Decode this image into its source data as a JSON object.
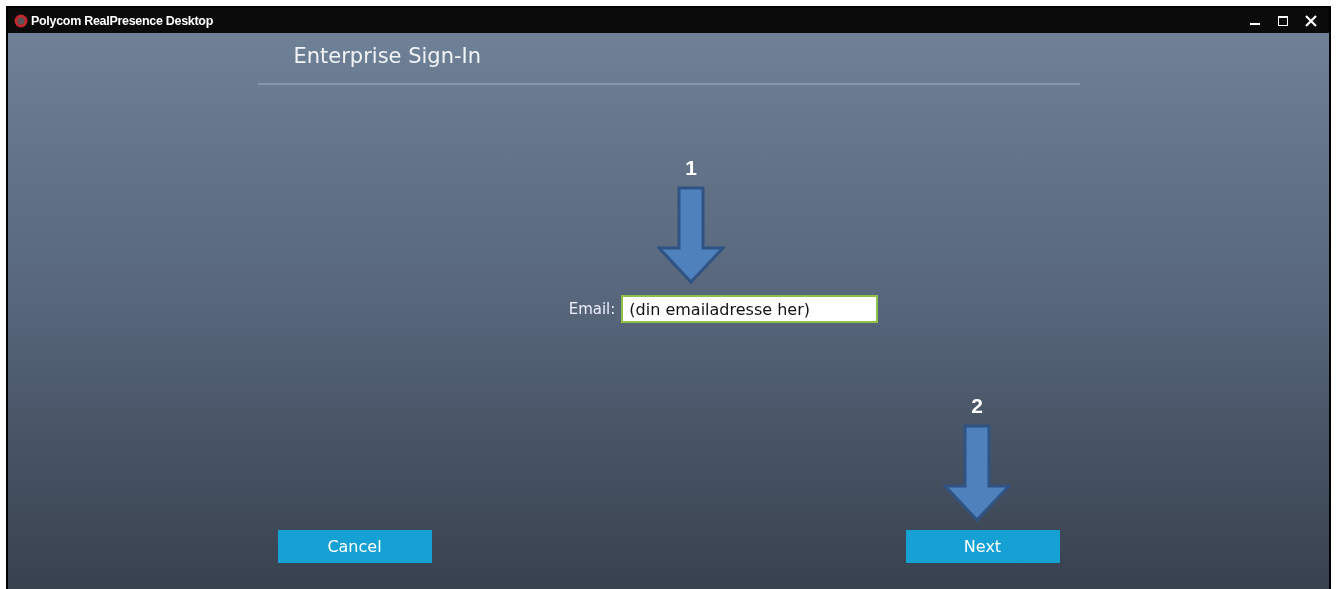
{
  "window": {
    "title": "Polycom RealPresence Desktop"
  },
  "heading": "Enterprise Sign-In",
  "email": {
    "label": "Email:",
    "value": "(din emailadresse her)"
  },
  "buttons": [
    {
      "label": "Cancel"
    },
    {
      "label": "Next"
    }
  ],
  "annotations": [
    {
      "label": "1"
    },
    {
      "label": "2"
    }
  ]
}
